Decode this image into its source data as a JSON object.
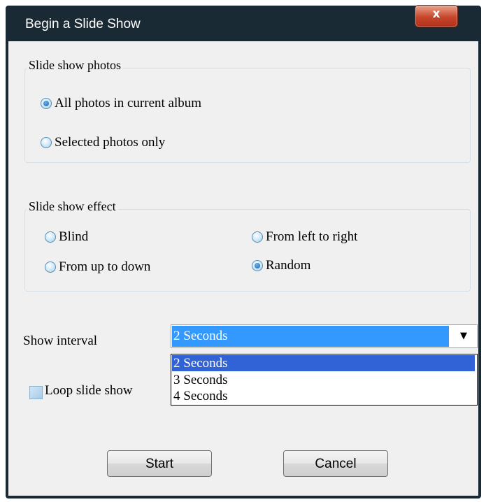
{
  "window": {
    "title": "Begin a Slide Show",
    "close_label": "x"
  },
  "photos_group": {
    "label": "Slide show photos",
    "options": [
      {
        "label": "All photos in current album",
        "selected": true
      },
      {
        "label": "Selected photos only",
        "selected": false
      }
    ]
  },
  "effect_group": {
    "label": "Slide show effect",
    "options": [
      {
        "label": "Blind",
        "selected": false
      },
      {
        "label": "From left to right",
        "selected": false
      },
      {
        "label": "From up to down",
        "selected": false
      },
      {
        "label": "Random",
        "selected": true
      }
    ]
  },
  "interval": {
    "label": "Show interval",
    "selected": "2 Seconds",
    "options": [
      "2 Seconds",
      "3 Seconds",
      "4 Seconds"
    ]
  },
  "loop": {
    "label": "Loop slide show",
    "checked": false
  },
  "buttons": {
    "start": "Start",
    "cancel": "Cancel"
  }
}
